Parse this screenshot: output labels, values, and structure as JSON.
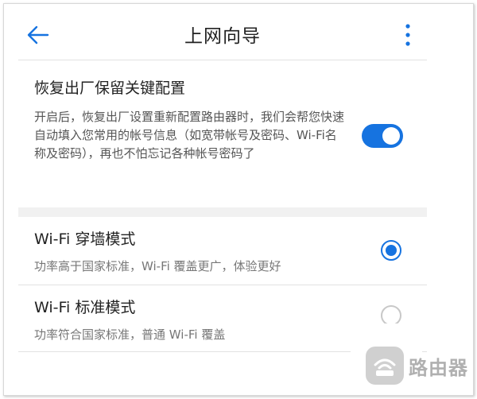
{
  "header": {
    "title": "上网向导",
    "back_icon": "arrow-left-icon",
    "more_icon": "more-vertical-icon"
  },
  "keep_config": {
    "title": "恢复出厂保留关键配置",
    "description": "开启后，恢复出厂设置重新配置路由器时，我们会帮您快速自动填入您常用的帐号信息（如宽带帐号及密码、Wi-Fi名称及密码），再也不怕忘记各种帐号密码了",
    "enabled": true
  },
  "modes": [
    {
      "title": "Wi-Fi 穿墙模式",
      "description": "功率高于国家标准，Wi-Fi 覆盖更广，体验更好",
      "selected": true
    },
    {
      "title": "Wi-Fi 标准模式",
      "description": "功率符合国家标准，普通 Wi-Fi 覆盖",
      "selected": false
    }
  ],
  "watermark": {
    "text": "路由器",
    "icon": "router-logo-icon"
  },
  "colors": {
    "accent": "#1673e0",
    "divider": "#e2e2e2",
    "section_gap": "#f1f1f1"
  }
}
